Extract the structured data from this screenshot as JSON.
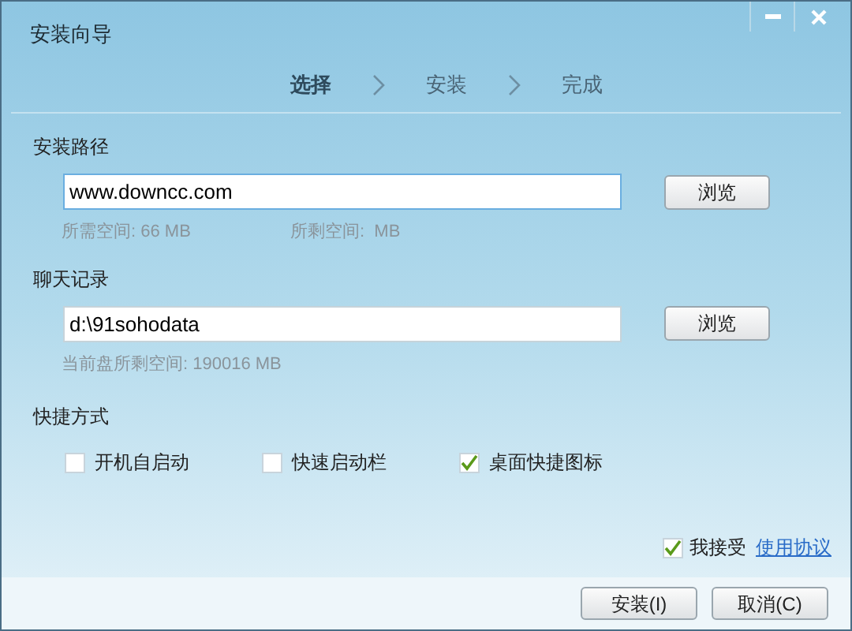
{
  "window": {
    "title": "安装向导"
  },
  "steps": [
    {
      "label": "选择",
      "selected": true
    },
    {
      "label": "安装",
      "selected": false
    },
    {
      "label": "完成",
      "selected": false
    }
  ],
  "install_path": {
    "label": "安装路径",
    "value": "www.downcc.com",
    "browse": "浏览",
    "required": "所需空间: 66 MB",
    "remaining": "所剩空间:  MB"
  },
  "chat_log": {
    "label": "聊天记录",
    "value": "d:\\91sohodata",
    "browse": "浏览",
    "remaining": "当前盘所剩空间: 190016 MB"
  },
  "shortcuts": {
    "label": "快捷方式",
    "options": [
      {
        "label": "开机自启动",
        "checked": false
      },
      {
        "label": "快速启动栏",
        "checked": false
      },
      {
        "label": "桌面快捷图标",
        "checked": true
      }
    ]
  },
  "agreement": {
    "label": "我接受",
    "checked": true,
    "link": "使用协议"
  },
  "buttons": [
    "安装(I)",
    "取消(C)"
  ]
}
